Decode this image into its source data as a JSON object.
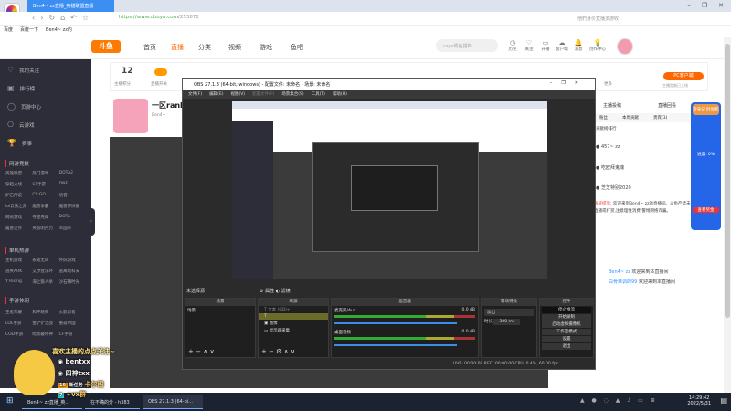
{
  "browser": {
    "tab_title": "Ben4~ zz直播_英雄联盟直播",
    "url_host": "https://www.douyu.com/",
    "url_path": "253872",
    "search_placeholder": "他們身价直播多游收",
    "bookmarks": [
      "百度",
      "百度一下",
      "Ben4~ zz的"
    ]
  },
  "header": {
    "logo": "斗鱼",
    "nav": [
      "首页",
      "直播",
      "分类",
      "视频",
      "游戏",
      "鱼吧"
    ],
    "search_placeholder": "csgo鳄鱼搭档",
    "icons": [
      "历史",
      "关注",
      "开播",
      "客户端",
      "消息",
      "创作中心"
    ]
  },
  "info": {
    "score": "12",
    "score_label": "主播积分",
    "switch_label": "直播开关",
    "more": "更多",
    "pc_btn": "PC客户端",
    "pc_sub": "主播定制已上线"
  },
  "room": {
    "title": "一区rank 2",
    "streamer": "Ben4~"
  },
  "sidebar": {
    "items": [
      "我的关注",
      "排行榜",
      "页游中心",
      "云游戏",
      "赛事"
    ],
    "sections": [
      {
        "title": "网游竞技",
        "more": "全部",
        "games": [
          "英雄联盟",
          "热门游戏",
          "DOTA2",
          "穿越火线",
          "CF手游",
          "DNF",
          "炉石传说",
          "CS:GO",
          "语音",
          "lol云顶之弈",
          "魔兽争霸",
          "魔兽怀旧服",
          "网易游戏",
          "守望先锋",
          "DOTA",
          "魔兽世界",
          "天涯明月刀",
          "三国杀"
        ]
      },
      {
        "title": "单机热游",
        "more": "全部",
        "games": [
          "主机游戏",
          "永劫无间",
          "怀旧游戏",
          "逃失ARK",
          "艾尔登法环",
          "逃离塔科夫",
          "Y Rising",
          "海上狼人杀",
          "沙石镇时光"
        ]
      },
      {
        "title": "手游休闲",
        "more": "全部",
        "games": [
          "王者荣耀",
          "和平精英",
          "火影忍者",
          "LOL手游",
          "金铲铲之战",
          "重返帝国",
          "COD手游",
          "暗黑破坏神",
          "CF手游"
        ]
      }
    ]
  },
  "right": {
    "tabs": [
      "主播投稿",
      "直播回看"
    ],
    "subtabs": [
      "粉丝",
      "本周贡献",
      "贵宾(3)"
    ],
    "rank_title": "贡献榜排行",
    "fans": [
      "457~ zz",
      "吃欧拜鬼魂",
      "芝芝特别2020"
    ],
    "notice_label": "系统提示:",
    "notice": "欢迎来到Ben4~ zz的直播间。斗鱼严禁未成年人直播或打赏,注意理性消费,警惕网络诈骗。",
    "chats": [
      {
        "user": "Ben4~ zz",
        "text": "欢迎来到本直播间"
      },
      {
        "user": "白骨难调的99",
        "text": "欢迎来到本直播间"
      }
    ]
  },
  "widget": {
    "title": "变身记 时尚机",
    "progress_label": "进度: 0%",
    "progress": 0,
    "btn": "查看奖金"
  },
  "obs": {
    "title": "OBS 27.1.3 (64-bit, windows) - 配置文件: 未命名 - 场景: 未命名",
    "menu": [
      "文件(F)",
      "编辑(E)",
      "视图(V)",
      "配置文件(P)",
      "场景集合(S)",
      "工具(T)",
      "帮助(H)"
    ],
    "no_source": "未选择源",
    "props": "属性",
    "filters": "滤镜",
    "docks": {
      "scenes": "场景",
      "sources": "来源",
      "mixer": "混音器",
      "transitions": "转场特效",
      "controls": "控件"
    },
    "scene_items": [
      "场景"
    ],
    "sources": [
      "文本 (GDI+)",
      "",
      "图像",
      "显示器采集"
    ],
    "mixer": [
      {
        "name": "麦克风/Aux",
        "db": "0.0 dB"
      },
      {
        "name": "桌面音频",
        "db": "0.0 dB"
      }
    ],
    "transition": "淡出",
    "duration_label": "时长",
    "duration": "300 ms",
    "controls": [
      "停止推流",
      "开始录制",
      "启动虚拟摄像机",
      "工作室模式",
      "设置",
      "退出"
    ],
    "status": "LIVE: 00:00:00   REC: 00:00:00   CPU: 0.4%, 60.00 fps"
  },
  "overlay": {
    "line1": "喜欢主播的点点关注~",
    "weibo": "bentxx",
    "netease": "四神txx",
    "lvl1": "19",
    "lvl1_label": "新任务",
    "text3": "卡尔图",
    "lvl2": "7",
    "text4": "+vx群"
  },
  "taskbar": {
    "apps": [
      "Ben4~ zz直播_英...",
      "在不确的分 - h383",
      "OBS 27.1.3 (64-bi..."
    ],
    "time": "14:29:42",
    "date": "2022/5/31"
  }
}
